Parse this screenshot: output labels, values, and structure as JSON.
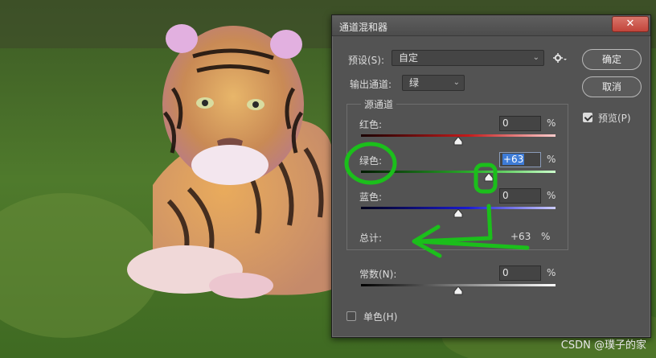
{
  "dialog": {
    "title": "通道混和器",
    "close_label": "✕",
    "preset_label": "预设(S):",
    "preset_value": "自定",
    "preset_options_icon": "gear-icon",
    "output_channel_label": "输出通道:",
    "output_channel_value": "绿",
    "ok_label": "确定",
    "cancel_label": "取消",
    "preview_label": "预览(P)",
    "preview_checked": true,
    "source_group_label": "源通道",
    "channels": [
      {
        "label": "红色:",
        "value": "0",
        "unit": "%",
        "slider_fraction": 0.5
      },
      {
        "label": "绿色:",
        "value": "+63",
        "unit": "%",
        "slider_fraction": 0.655
      },
      {
        "label": "蓝色:",
        "value": "0",
        "unit": "%",
        "slider_fraction": 0.5
      }
    ],
    "total_label": "总计:",
    "total_value": "+63",
    "total_unit": "%",
    "constant_label": "常数(N):",
    "constant_value": "0",
    "constant_unit": "%",
    "constant_slider_fraction": 0.5,
    "monochrome_label": "单色(H)",
    "monochrome_checked": false
  },
  "watermark": "CSDN @璞子的家",
  "colors": {
    "dialog_bg": "#535353",
    "red_track": "#c21a1a",
    "green_track": "#2fb52f",
    "blue_track": "#1a1ad0",
    "annotation": "#1bbf1b",
    "highlight": "#3d7bd6"
  }
}
